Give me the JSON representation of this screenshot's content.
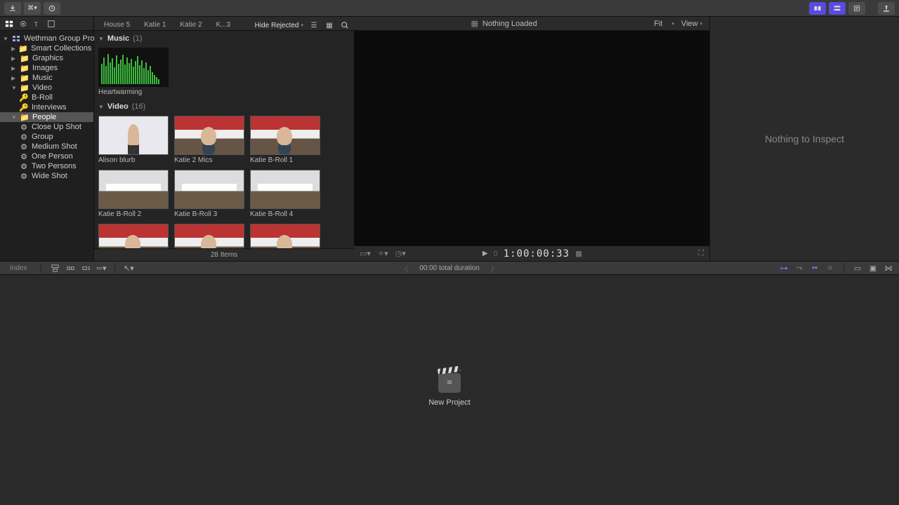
{
  "toolbar": {
    "import_tip": "Import",
    "keyword_tip": "Keyword",
    "bg_tasks_tip": "Background Tasks"
  },
  "sidebar": {
    "library_name": "Wethman Group Promo",
    "items": [
      {
        "label": "Smart Collections",
        "icon": "star"
      },
      {
        "label": "Graphics",
        "icon": "folder"
      },
      {
        "label": "Images",
        "icon": "folder"
      },
      {
        "label": "Music",
        "icon": "folder"
      },
      {
        "label": "Video",
        "icon": "folder",
        "expanded": true,
        "children": [
          {
            "label": "B-Roll",
            "icon": "tag"
          },
          {
            "label": "Interviews",
            "icon": "tag"
          }
        ]
      },
      {
        "label": "People",
        "icon": "folder",
        "expanded": true,
        "selected": true,
        "children": [
          {
            "label": "Close Up Shot",
            "icon": "gear"
          },
          {
            "label": "Group",
            "icon": "gear"
          },
          {
            "label": "Medium Shot",
            "icon": "gear"
          },
          {
            "label": "One Person",
            "icon": "gear"
          },
          {
            "label": "Two Persons",
            "icon": "gear"
          },
          {
            "label": "Wide Shot",
            "icon": "gear"
          }
        ]
      }
    ]
  },
  "browser": {
    "tabs": [
      "House 5",
      "Katie 1",
      "Katie 2",
      "K...3"
    ],
    "filter_label": "Hide Rejected",
    "sections": [
      {
        "title": "Music",
        "count": "(1)",
        "clips": [
          {
            "label": "Heartwarming",
            "kind": "audio"
          }
        ]
      },
      {
        "title": "Video",
        "count": "(16)",
        "clips": [
          {
            "label": "Alison blurb",
            "kind": "podium"
          },
          {
            "label": "Katie 2 Mics",
            "kind": "interview"
          },
          {
            "label": "Katie B-Roll 1",
            "kind": "interview"
          },
          {
            "label": "Katie B-Roll 2",
            "kind": "meeting"
          },
          {
            "label": "Katie B-Roll 3",
            "kind": "meeting"
          },
          {
            "label": "Katie B-Roll 4",
            "kind": "meeting"
          },
          {
            "label": "",
            "kind": "interview"
          },
          {
            "label": "",
            "kind": "interview"
          },
          {
            "label": "",
            "kind": "interview"
          }
        ]
      }
    ],
    "footer": "28 Items"
  },
  "viewer": {
    "title": "Nothing Loaded",
    "fit_label": "Fit",
    "view_label": "View",
    "timecode_prefix": "0",
    "timecode": "1:00:00:33"
  },
  "inspector": {
    "empty_label": "Nothing to Inspect"
  },
  "timeline_strip": {
    "index_label": "Index",
    "duration_label": "00:00 total duration"
  },
  "timeline": {
    "new_project_label": "New Project"
  }
}
